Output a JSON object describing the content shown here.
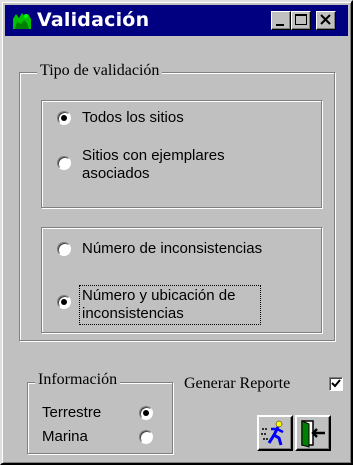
{
  "window": {
    "title": "Validación"
  },
  "tipo_validacion": {
    "label": "Tipo de validación",
    "group_a": [
      {
        "label": "Todos los sitios",
        "checked": true
      },
      {
        "label": "Sitios con ejemplares asociados",
        "line1": "Sitios con ejemplares",
        "line2": "asociados",
        "checked": false
      }
    ],
    "group_b": [
      {
        "label": "Número de inconsistencias",
        "checked": false
      },
      {
        "label": "Número y ubicación de inconsistencias",
        "line1": "Número y ubicación de",
        "line2": "inconsistencias",
        "checked": true
      }
    ]
  },
  "informacion": {
    "label": "Información",
    "options": [
      {
        "label": "Terrestre",
        "checked": true
      },
      {
        "label": "Marina",
        "checked": false
      }
    ]
  },
  "generar_reporte": {
    "label": "Generar Reporte",
    "checked": true
  },
  "icons": [
    "app-icon",
    "minimize-icon",
    "maximize-icon",
    "close-icon",
    "run-icon",
    "exit-door-icon"
  ],
  "colors": {
    "titlebar": "#000080",
    "face": "#c0c0c0",
    "icon_blue": "#0000ff",
    "icon_yellow": "#ffff00",
    "icon_green": "#008000"
  }
}
